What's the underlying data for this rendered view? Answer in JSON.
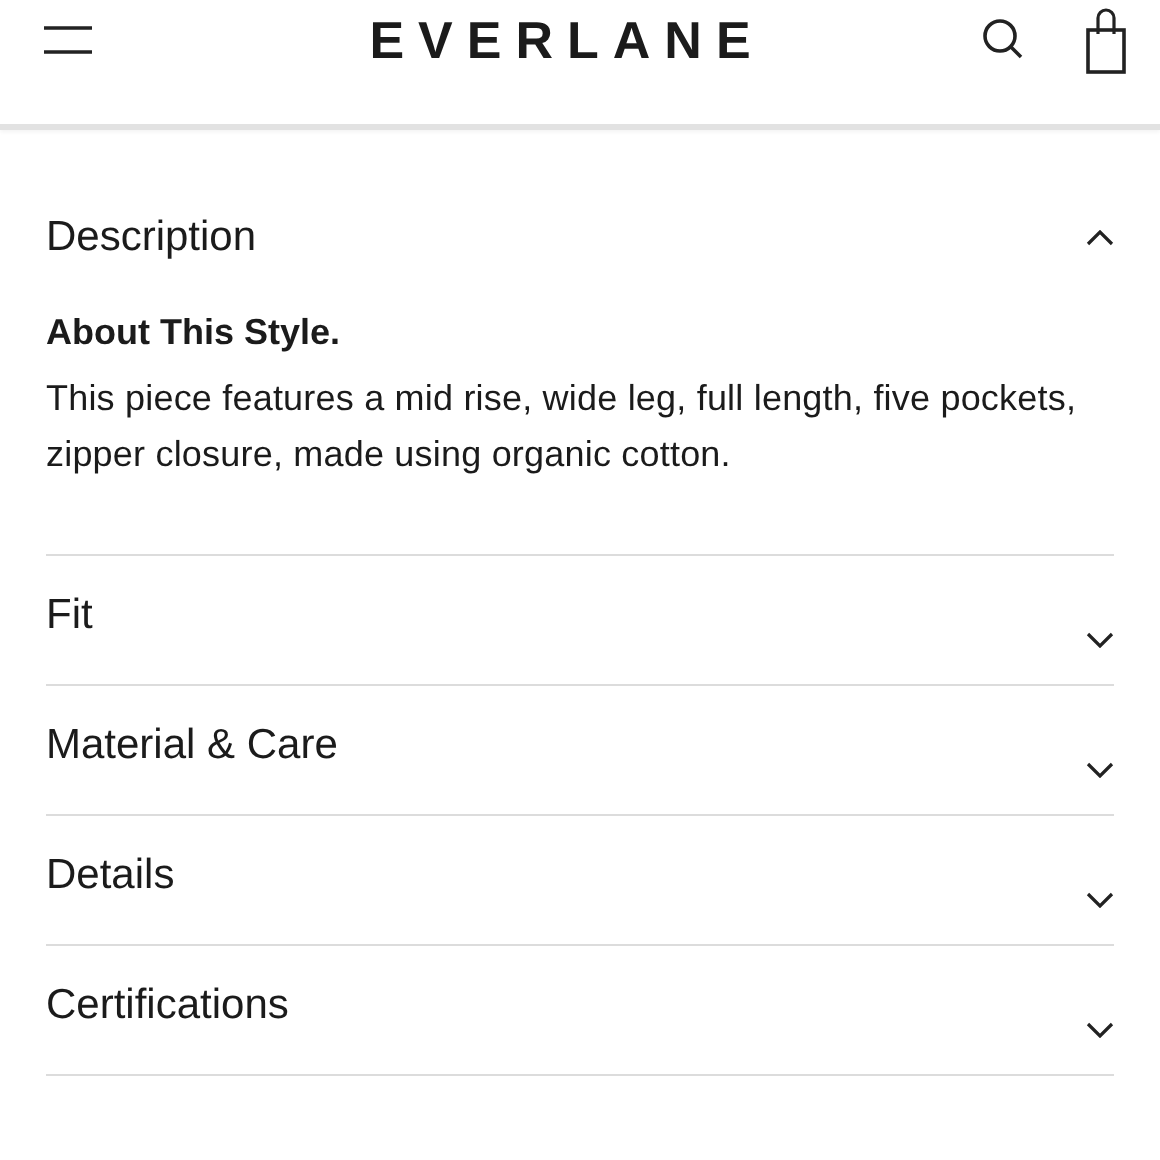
{
  "header": {
    "logo": "EVERLANE"
  },
  "sections": [
    {
      "title": "Description",
      "expanded": true,
      "subtitle": "About This Style.",
      "body": "This piece features a mid rise, wide leg, full length, five pockets, zipper closure, made using organic cotton."
    },
    {
      "title": "Fit",
      "expanded": false
    },
    {
      "title": "Material & Care",
      "expanded": false
    },
    {
      "title": "Details",
      "expanded": false
    },
    {
      "title": "Certifications",
      "expanded": false
    }
  ]
}
